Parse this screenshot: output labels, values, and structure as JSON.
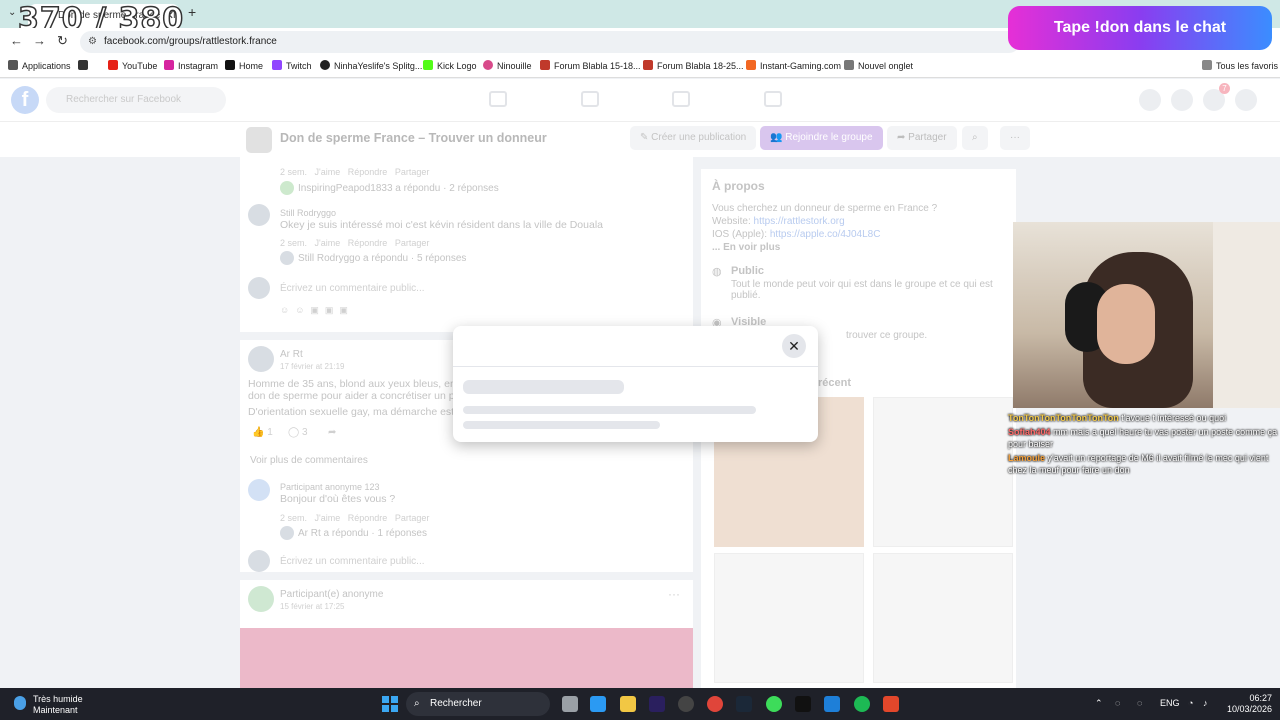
{
  "browser": {
    "tab_title": "Don de sperme France – Tro",
    "url": "facebook.com/groups/rattlestork.france",
    "bookmarks": [
      "Applications",
      "YouTube",
      "Instagram",
      "Home",
      "Twitch",
      "NinhaYeslife's Splitg...",
      "Kick Logo",
      "Ninouille",
      "Forum Blabla 15-18...",
      "Forum Blabla 18-25...",
      "Instant-Gaming.com",
      "Nouvel onglet"
    ],
    "all_bookmarks": "Tous les favoris"
  },
  "overlay": {
    "counter": "370 / 380",
    "don_banner": "Tape !don dans le chat",
    "chat": [
      {
        "nick": "TonTonTonTonTonTonTon",
        "msg": "t'avoue t intéressé ou quoi"
      },
      {
        "nick": "Sofiah404",
        "msg": "mm mais a quel heure tu vas poster un poste comme ça pour baiser"
      },
      {
        "nick": "Lamoule",
        "msg": "y'avait un reportage de M6 il avait filmé le mec qui vient chez la meuf pour faire un don"
      }
    ]
  },
  "facebook": {
    "search_placeholder": "Rechercher sur Facebook",
    "notif_count": "7",
    "group_title": "Don de sperme France – Trouver un donneur",
    "create_post": "Créer une publication",
    "join_group": "Rejoindre le groupe",
    "share": "Partager",
    "actions": [
      "J'aime",
      "Répondre",
      "Partager"
    ],
    "comment_placeholder": "Écrivez un commentaire public...",
    "posts": {
      "reply1_time": "2 sem.",
      "reply1_summary": "InspiringPeapod1833 a répondu · 2 réponses",
      "c2_author": "Still Rodryggo",
      "c2_text": "Okey je suis intéressé moi c'est kévin résident dans la ville de Douala",
      "c2_time": "2 sem.",
      "c2_summary": "Still Rodryggo a répondu · 5 réponses",
      "p2_author": "Ar Rt",
      "p2_date": "17 février at 21:19",
      "p2_line1": "Homme de 35 ans, blond aux yeux bleus, en bo",
      "p2_line2": "don de sperme pour aider a concrétiser un pro",
      "p2_line3": "D'orientation sexuelle gay, ma démarche est sa",
      "p2_likes": "1",
      "p2_comments": "3",
      "more_comments": "Voir plus de commentaires",
      "c3_author": "Participant anonyme 123",
      "c3_text": "Bonjour d'où êtes vous ?",
      "c3_time": "2 sem.",
      "c3_summary": "Ar Rt a répondu · 1 réponses",
      "p3_author": "Participant(e) anonyme",
      "p3_date": "15 février at 17:25"
    },
    "about": {
      "title": "À propos",
      "desc": "Vous cherchez un donneur de sperme en France ?",
      "website_label": "Website:",
      "website": "https://rattlestork.org",
      "ios_label": "IOS (Apple):",
      "ios": "https://apple.co/4J04L8C",
      "see_more": "... En voir plus",
      "public_title": "Public",
      "public_desc": "Tout le monde peut voir qui est dans le groupe et ce qui est publié.",
      "visible_title": "Visible",
      "visible_desc": "trouver ce groupe.",
      "recent": "récent"
    }
  },
  "taskbar": {
    "weather_title": "Très humide",
    "weather_sub": "Maintenant",
    "search": "Rechercher",
    "lang": "ENG",
    "time": "06:27",
    "date": "10/03/2026"
  }
}
